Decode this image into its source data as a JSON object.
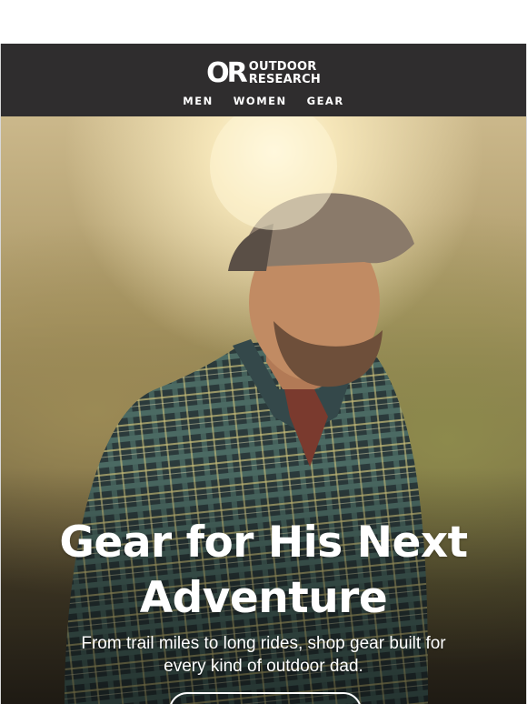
{
  "brand": {
    "mark": "OR",
    "name_line1": "OUTDOOR",
    "name_line2": "RESEARCH"
  },
  "nav": {
    "items": [
      {
        "label": "MEN"
      },
      {
        "label": "WOMEN"
      },
      {
        "label": "GEAR"
      }
    ]
  },
  "hero": {
    "title": "Gear for His Next Adventure",
    "subtitle": "From trail miles to long rides, shop gear built for every kind of outdoor dad."
  },
  "colors": {
    "header_bg": "#2f2d2e",
    "text": "#ffffff"
  }
}
